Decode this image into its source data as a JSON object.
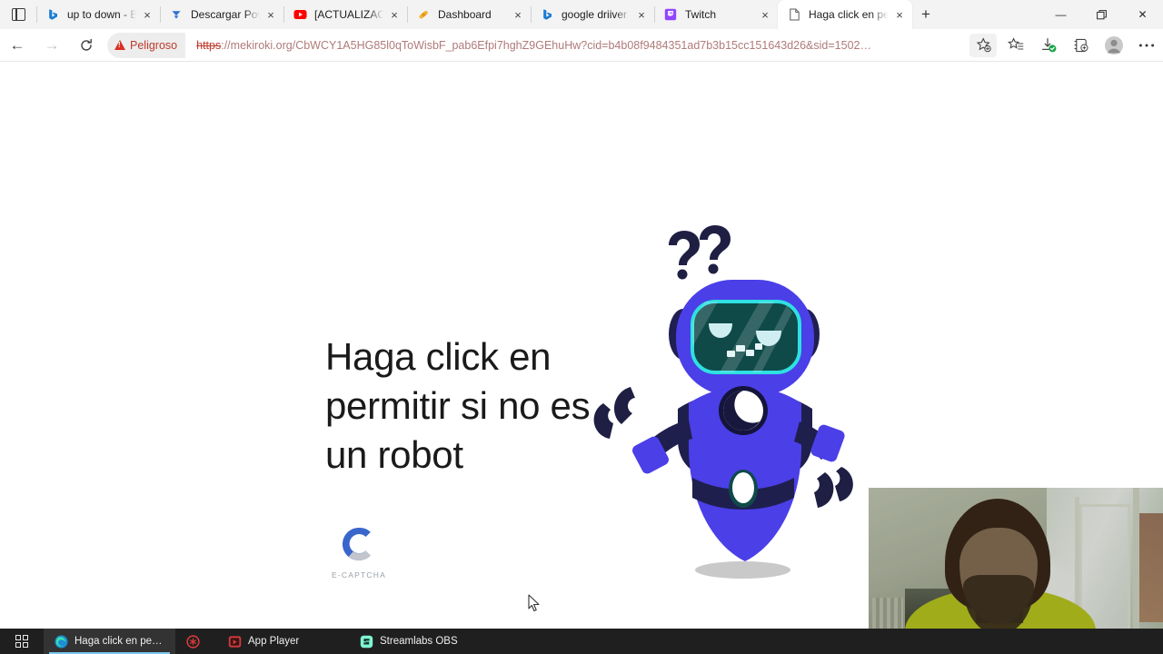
{
  "browser": {
    "tabs": [
      {
        "title": "up to down - Bing",
        "favicon": "bing-icon",
        "active": false
      },
      {
        "title": "Descargar Power",
        "favicon": "download-arrow-icon",
        "active": false
      },
      {
        "title": "[ACTUALIZAC",
        "favicon": "youtube-icon",
        "active": false
      },
      {
        "title": "Dashboard",
        "favicon": "bandage-icon",
        "active": false
      },
      {
        "title": "google driiver - B",
        "favicon": "bing-icon",
        "active": false
      },
      {
        "title": "Twitch",
        "favicon": "twitch-icon",
        "active": false
      },
      {
        "title": "Haga click en per",
        "favicon": "page-icon",
        "active": true
      }
    ],
    "tab_close_label": "×",
    "new_tab_label": "+",
    "window_controls": {
      "minimize": "—",
      "maximize": "❐",
      "close": "✕"
    },
    "nav": {
      "back": "←",
      "forward": "→",
      "reload": "↻"
    },
    "address_bar": {
      "security_label": "Peligroso",
      "security_icon": "warning-triangle-icon",
      "url_scheme": "https",
      "url_after_scheme": "://mekiroki.org/CbWCY1A5HG85l0qToWisbF_pab6Efpi7hghZ9GEhuHw?cid=b4b08f9484351ad7b3b15cc151643d26&sid=1502…",
      "url_full": "https://mekiroki.org/CbWCY1A5HG85l0qToWisbF_pab6Efpi7hghZ9GEhuHw?cid=b4b08f9484351ad7b3b15cc151643d26&sid=1502…"
    },
    "toolbar_icons": [
      {
        "name": "add-favorite-icon"
      },
      {
        "name": "favorites-icon"
      },
      {
        "name": "downloads-icon"
      },
      {
        "name": "collections-icon"
      },
      {
        "name": "profile-avatar-icon"
      },
      {
        "name": "settings-more-icon"
      }
    ]
  },
  "page": {
    "headline": "Haga click en permitir si no es un robot",
    "captcha_brand": "E-CAPTCHA",
    "captcha_logo_name": "e-captcha-logo",
    "illustration_name": "confused-robot-illustration",
    "colors": {
      "robot_body": "#4040e8",
      "robot_dark": "#1f1f54",
      "robot_screen": "#0f4a49",
      "robot_screen_border": "#2fe0e0",
      "captcha_blue": "#3a66cc",
      "captcha_gray": "#c2c6cc",
      "danger_red": "#c0392b"
    }
  },
  "taskbar": {
    "start_label": "start-button",
    "items": [
      {
        "label": "Haga click en permit...",
        "icon": "edge-icon",
        "active": true
      },
      {
        "label": "",
        "icon": "red-circle-icon",
        "active": false
      },
      {
        "label": "App Player",
        "icon": "app-player-icon",
        "active": false
      },
      {
        "label": "Streamlabs OBS",
        "icon": "streamlabs-icon",
        "active": false
      }
    ]
  },
  "webcam": {
    "name": "webcam-overlay"
  }
}
